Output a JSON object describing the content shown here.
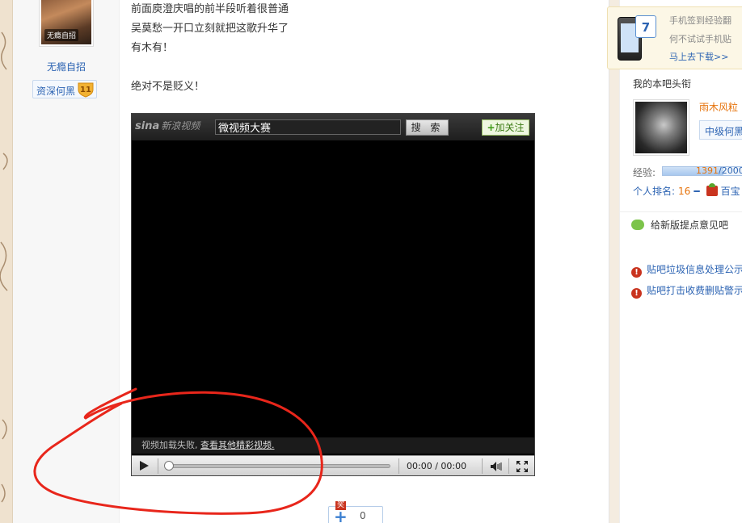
{
  "author": {
    "avatar_tag": "无瘾自招",
    "name": "无瘾自招",
    "badge_label": "资深何黑",
    "badge_level": "11"
  },
  "post": {
    "lines": [
      "前面庾澄庆唱的前半段听着很普通",
      "吴莫愁一开口立刻就把这歌升华了",
      "有木有！",
      "",
      "绝对不是贬义！"
    ]
  },
  "player": {
    "logo_en": "sina",
    "logo_cn": "新浪视频",
    "search_value": "微视频大赛",
    "search_button": "搜 索",
    "follow_button": "加关注",
    "fail_text": "视频加载失败,",
    "fail_link": "查看其他精彩视频.",
    "time_current": "00:00",
    "time_sep": "/",
    "time_total": "00:00",
    "progress": 0
  },
  "like": {
    "badge": "奖",
    "count": "0"
  },
  "sidebar": {
    "promo_line1": "手机签到经验翻",
    "promo_line2": "何不试试手机贴",
    "promo_link": "马上去下载>>",
    "promo_calendar": "7",
    "section_title": "我的本吧头衔",
    "username": "雨木风粒",
    "level_label": "中级何黑",
    "exp_label": "经验:",
    "exp_current": "1391",
    "exp_total": "/2000",
    "exp_fraction": 0.6955,
    "rank_label": "个人排名:",
    "rank_value": "16",
    "rank_trend": "━",
    "treasure_label": "百宝",
    "feedback": "给新版提点意见吧",
    "notices": [
      "贴吧垃圾信息处理公示",
      "贴吧打击收费删贴警示"
    ]
  }
}
